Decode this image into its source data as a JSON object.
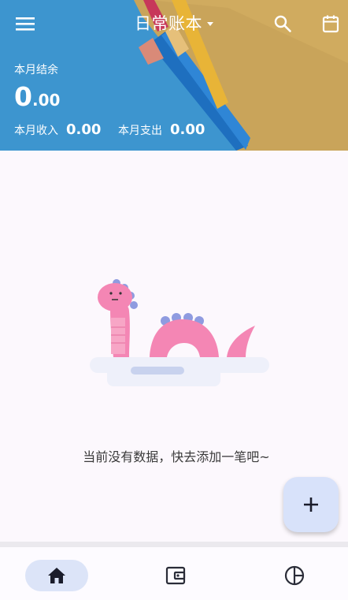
{
  "app": {
    "title": "日常账本",
    "menu_icon": "menu-icon",
    "search_icon": "search-icon",
    "calendar_icon": "calendar-icon"
  },
  "summary": {
    "balance_label": "本月结余",
    "balance_int": "0",
    "balance_dec": ".00",
    "income_label": "本月收入",
    "income_value": "0.00",
    "expense_label": "本月支出",
    "expense_value": "0.00"
  },
  "empty_state": {
    "illustration_icon": "dinosaur-illustration",
    "message": "当前没有数据，快去添加一笔吧~"
  },
  "fab": {
    "icon": "plus-icon"
  },
  "bottom_nav": {
    "items": [
      {
        "icon": "home-icon",
        "active": true
      },
      {
        "icon": "wallet-icon",
        "active": false
      },
      {
        "icon": "pie-chart-icon",
        "active": false
      }
    ]
  },
  "colors": {
    "header_blue": "#3d95cf",
    "accent_pill": "#dce4f8",
    "fab": "#d8e2fa",
    "dino_pink": "#f486b4"
  }
}
